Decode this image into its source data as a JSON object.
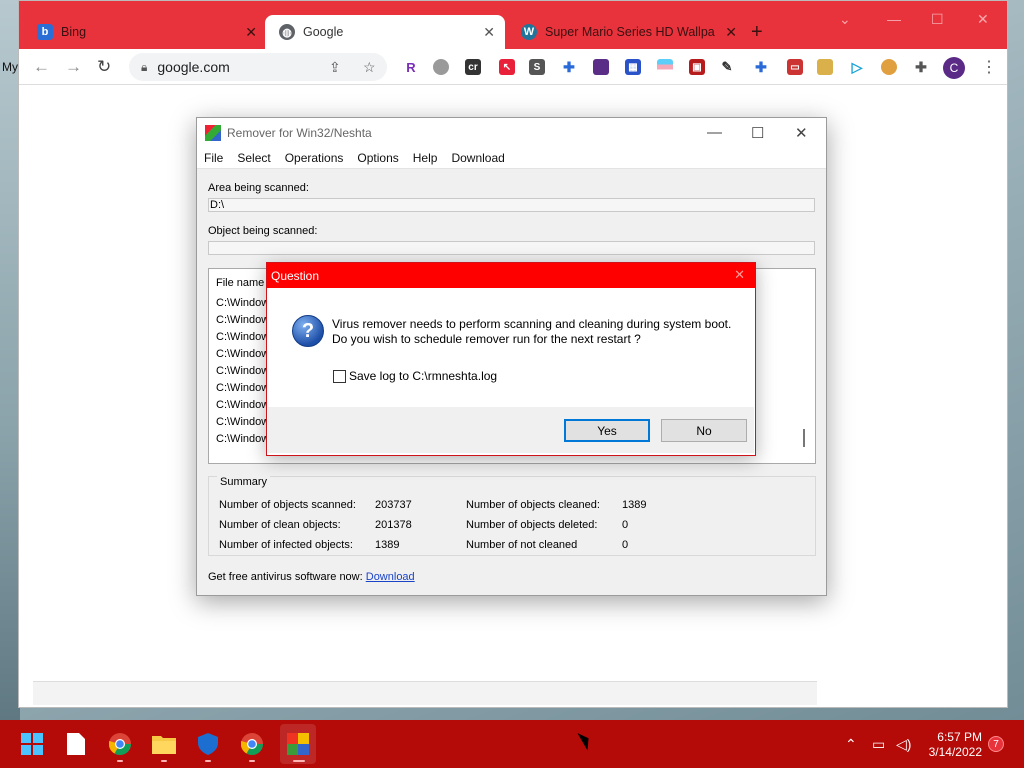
{
  "desktop": {
    "partial_label": "My"
  },
  "browser": {
    "tabs": [
      {
        "label": "Bing"
      },
      {
        "label": "Google"
      },
      {
        "label": "Super Mario Series HD Wallpape"
      }
    ],
    "address": "google.com",
    "profile_initial": "C"
  },
  "remover": {
    "title": "Remover for Win32/Neshta",
    "menu": [
      "File",
      "Select",
      "Operations",
      "Options",
      "Help",
      "Download"
    ],
    "area_label": "Area being scanned:",
    "area_value": "D:\\",
    "object_label": "Object being scanned:",
    "object_value": "",
    "list_header": "File name",
    "files": [
      "C:\\Window",
      "C:\\Window",
      "C:\\Window",
      "C:\\Window",
      "C:\\Window",
      "C:\\Window",
      "C:\\Window",
      "C:\\Window",
      "C:\\Window"
    ],
    "summary": {
      "title": "Summary",
      "scanned_label": "Number of objects scanned:",
      "scanned": "203737",
      "clean_label": "Number of clean objects:",
      "clean": "201378",
      "infected_label": "Number of infected objects:",
      "infected": "1389",
      "cleaned_label": "Number of objects cleaned:",
      "cleaned": "1389",
      "deleted_label": "Number of objects deleted:",
      "deleted": "0",
      "not_cleaned_label": "Number of not cleaned",
      "not_cleaned": "0"
    },
    "footer_text": "Get free antivirus software now:",
    "footer_link": "Download"
  },
  "dialog": {
    "title": "Question",
    "line1": "Virus remover needs to perform scanning and cleaning during system boot.",
    "line2": "Do you wish to schedule remover run for the next restart ?",
    "checkbox_label": "Save log to C:\\rmneshta.log",
    "yes": "Yes",
    "no": "No"
  },
  "taskbar": {
    "time": "6:57 PM",
    "date": "3/14/2022",
    "notifications": "7"
  },
  "colors": {
    "titlebar_red": "#e8333d",
    "dialog_red": "#ff0000",
    "taskbar": "#b40a08"
  }
}
